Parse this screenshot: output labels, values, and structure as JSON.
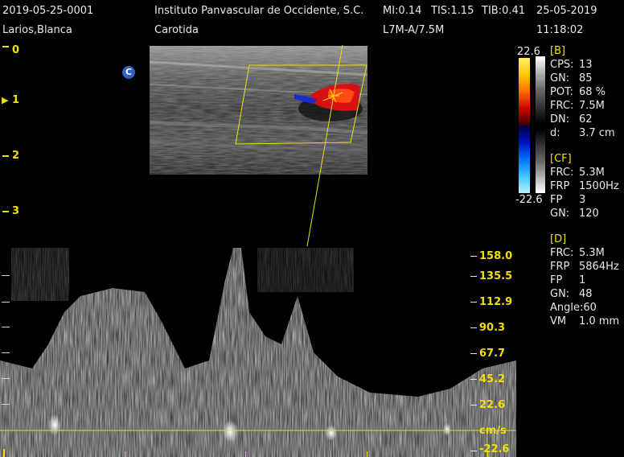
{
  "header": {
    "exam_id": "2019-05-25-0001",
    "institution": "Instituto Panvascular de Occidente, S.C.",
    "mi": "MI:0.14",
    "tis": "TIS:1.15",
    "tib": "TIB:0.41",
    "date": "25-05-2019",
    "patient": "Larios,Blanca",
    "exam_type": "Carotida",
    "probe": "L7M-A/7.5M",
    "time": "11:18:02"
  },
  "depth_scale": [
    "0",
    "1",
    "2",
    "3"
  ],
  "depth_marker": "▶",
  "badge": "C",
  "color_scale": {
    "top": "22.6",
    "bottom": "-22.6"
  },
  "b_params": {
    "title": "[B]",
    "rows": [
      {
        "label": "CPS:",
        "value": "13"
      },
      {
        "label": "GN:",
        "value": "85"
      },
      {
        "label": "POT:",
        "value": "68 %"
      },
      {
        "label": "FRC:",
        "value": "7.5M"
      },
      {
        "label": "DN:",
        "value": "62"
      },
      {
        "label": "d:",
        "value": "3.7 cm"
      }
    ]
  },
  "cf_params": {
    "title": "[CF]",
    "rows": [
      {
        "label": "FRC:",
        "value": "5.3M"
      },
      {
        "label": "FRP",
        "value": "1500Hz"
      },
      {
        "label": "FP",
        "value": "3"
      },
      {
        "label": "GN:",
        "value": "120"
      }
    ]
  },
  "d_params": {
    "title": "[D]",
    "rows": [
      {
        "label": "FRC:",
        "value": "5.3M"
      },
      {
        "label": "FRP",
        "value": "5864Hz"
      },
      {
        "label": "FP",
        "value": "1"
      },
      {
        "label": "GN:",
        "value": "48"
      },
      {
        "label": "Angle:60",
        "value": ""
      },
      {
        "label": "VM",
        "value": "1.0 mm"
      }
    ]
  },
  "velocity_scale": [
    "158.0",
    "135.5",
    "112.9",
    "90.3",
    "67.7",
    "45.2",
    "22.6",
    "cm/s",
    "-22.6"
  ],
  "colors": {
    "accent": "#f0e000",
    "flow_red": "#e01010",
    "flow_blue": "#1a2bd0"
  }
}
